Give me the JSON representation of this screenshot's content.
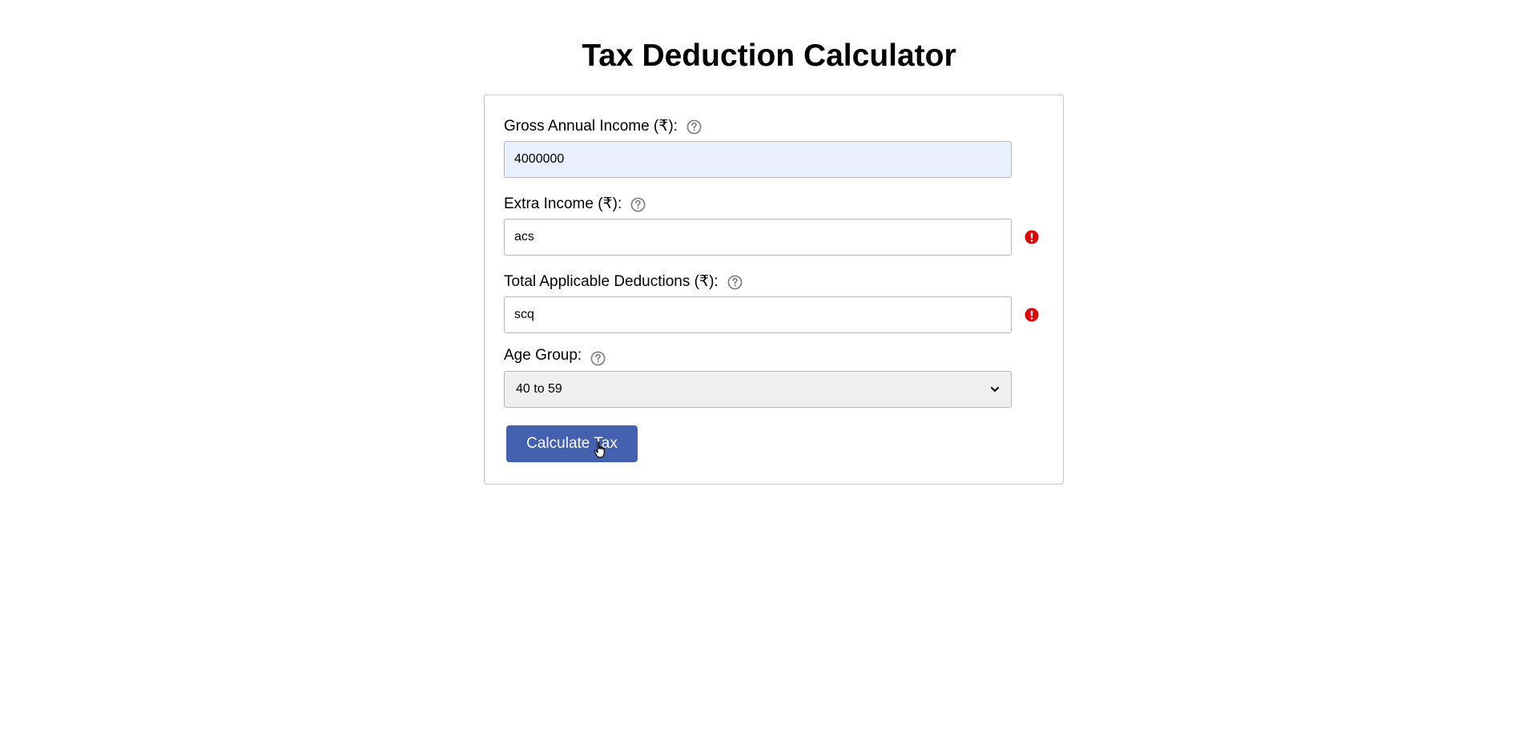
{
  "page": {
    "title": "Tax Deduction Calculator"
  },
  "form": {
    "gross_income": {
      "label": "Gross Annual Income (₹):",
      "value": "4000000",
      "help_icon": "question-circle-icon"
    },
    "extra_income": {
      "label": "Extra Income (₹):",
      "value": "acs",
      "help_icon": "question-circle-icon",
      "error_icon": "exclamation-circle-icon"
    },
    "deductions": {
      "label": "Total Applicable Deductions (₹):",
      "value": "scq",
      "help_icon": "question-circle-icon",
      "error_icon": "exclamation-circle-icon"
    },
    "age_group": {
      "label": "Age Group:",
      "selected": "40 to 59",
      "help_icon": "question-circle-icon"
    },
    "submit": {
      "label": "Calculate Tax"
    }
  },
  "colors": {
    "button_bg": "#4461b0",
    "button_text": "#ffffff",
    "error": "#e00000",
    "help_icon": "#808080",
    "autofill_bg": "#e8f0fe",
    "select_bg": "#efefef"
  }
}
